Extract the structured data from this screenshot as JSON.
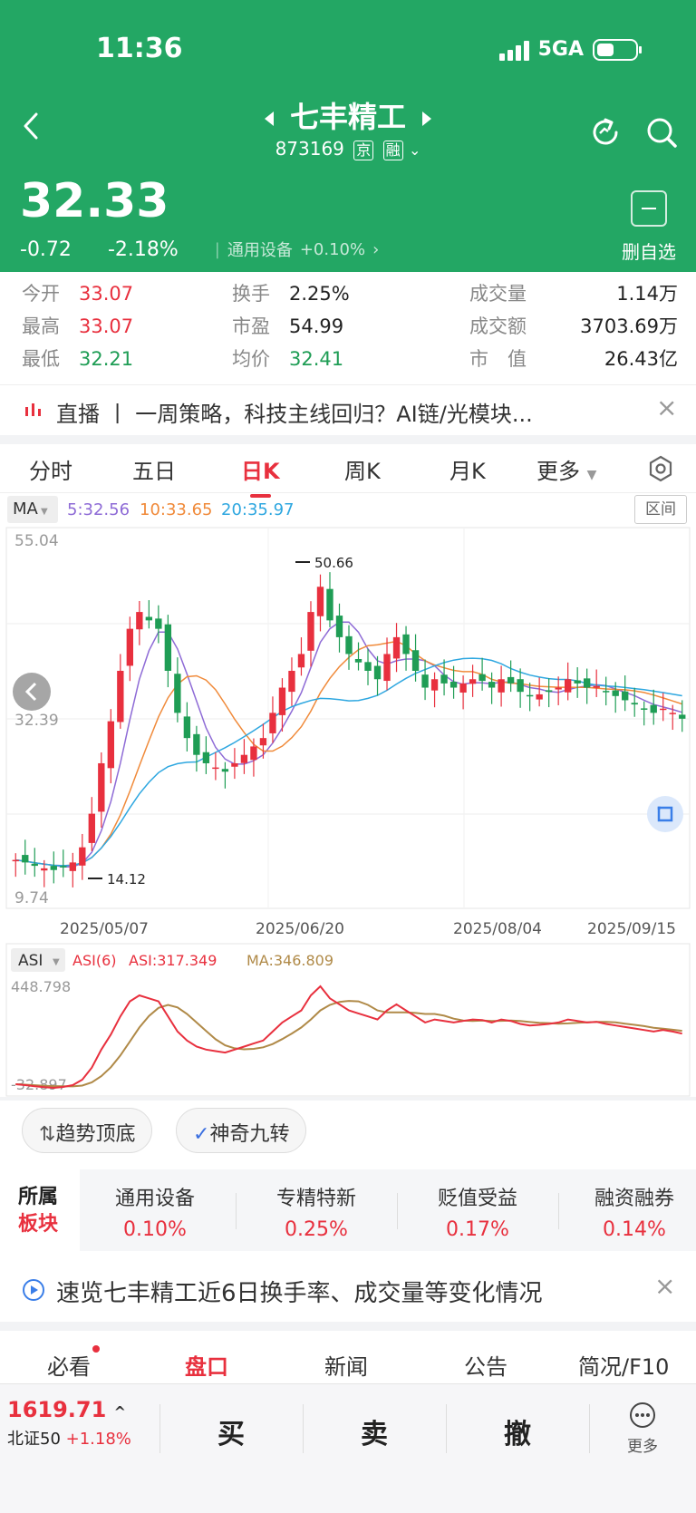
{
  "status_bar": {
    "time": "11:36",
    "network": "5GA"
  },
  "header": {
    "title": "七丰精工",
    "code": "873169",
    "tag1": "京",
    "tag2": "融"
  },
  "quote_main": {
    "price": "32.33",
    "change": "-0.72",
    "change_pct": "-2.18%",
    "sector": "通用设备",
    "sector_pct": "+0.10%",
    "watch_label": "删自选"
  },
  "quote_table": [
    {
      "label": "今开",
      "value": "33.07"
    },
    {
      "label": "最高",
      "value": "33.07"
    },
    {
      "label": "最低",
      "value": "32.21"
    },
    {
      "label": "换手",
      "value": "2.25%"
    },
    {
      "label": "市盈",
      "value": "54.99"
    },
    {
      "label": "均价",
      "value": "32.41"
    },
    {
      "label": "成交量",
      "value": "1.14万"
    },
    {
      "label": "成交额",
      "value": "3703.69万"
    },
    {
      "label": "市　值",
      "value": "26.43亿"
    }
  ],
  "live_banner": {
    "text": "直播 丨 一周策略，科技主线回归？AI链/光模块..."
  },
  "chart_tabs": [
    "分时",
    "五日",
    "日K",
    "周K",
    "月K",
    "更多"
  ],
  "ma_bar": {
    "label": "MA",
    "ma5": "5:32.56",
    "ma10": "10:33.65",
    "ma20": "20:35.97",
    "range_btn": "区间"
  },
  "kchart": {
    "y_top": "55.04",
    "y_mid": "32.39",
    "y_bot": "9.74",
    "high_label": "50.66",
    "low_label": "14.12",
    "dates": [
      "2025/05/07",
      "2025/06/20",
      "2025/08/04",
      "2025/09/15"
    ]
  },
  "asi": {
    "label": "ASI",
    "asi6": "ASI(6)",
    "value": "ASI:317.349",
    "ma": "MA:346.809",
    "top": "448.798",
    "bot": "-32.897"
  },
  "pills": [
    "趋势顶底",
    "神奇九转"
  ],
  "blocks_title": [
    "所属",
    "板块"
  ],
  "blocks": [
    {
      "name": "通用设备",
      "pct": "0.10%"
    },
    {
      "name": "专精特新",
      "pct": "0.25%"
    },
    {
      "name": "贬值受益",
      "pct": "0.17%"
    },
    {
      "name": "融资融券",
      "pct": "0.14%"
    }
  ],
  "info_banner": "速览七丰精工近6日换手率、成交量等变化情况",
  "bottom_nav": [
    "必看",
    "盘口",
    "新闻",
    "公告",
    "简况/F10"
  ],
  "index": {
    "value": "1619.71",
    "name": "北证50",
    "pct": "+1.18%"
  },
  "actions": [
    "买",
    "卖",
    "撤"
  ],
  "more": "更多",
  "colors": {
    "brand": "#23a764",
    "up": "#e8303e",
    "down": "#1f9d55"
  },
  "chart_data": {
    "type": "candlestick",
    "x_dates": [
      "2025/05/07",
      "2025/06/20",
      "2025/08/04",
      "2025/09/15"
    ],
    "ylim": [
      9.74,
      55.04
    ],
    "max_point": 50.66,
    "min_point": 14.12,
    "close_approx": [
      15.5,
      15.2,
      14.8,
      14.5,
      14.3,
      14.6,
      15.2,
      17,
      21,
      27,
      32,
      38,
      43,
      45,
      44,
      43,
      38,
      33,
      30,
      28,
      27,
      26.5,
      26,
      27,
      28,
      29,
      30,
      33,
      36,
      38,
      40,
      45,
      48,
      44,
      42,
      40,
      39,
      38,
      37,
      40,
      42,
      40,
      38,
      36,
      37,
      36.5,
      36,
      36.5,
      37,
      36.8,
      36,
      37,
      36.5,
      35.5,
      35,
      35.2,
      35.5,
      36,
      37,
      36.5,
      36,
      36.2,
      35.5,
      35,
      34.5,
      34,
      33.5,
      33,
      33.5,
      33,
      32.3
    ],
    "ma5": "32.56",
    "ma10": "33.65",
    "ma20": "35.97"
  }
}
